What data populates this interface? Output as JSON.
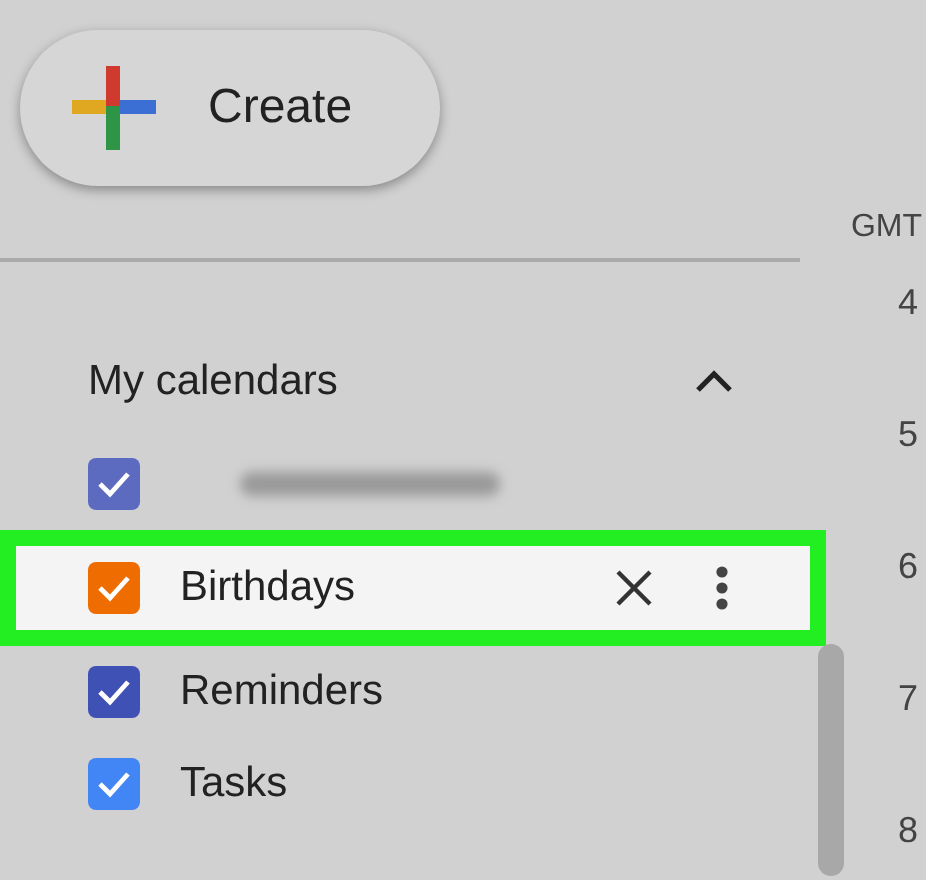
{
  "create_button": {
    "label": "Create"
  },
  "timezone": "GMT",
  "hours": [
    "4",
    "5",
    "6",
    "7",
    "8"
  ],
  "my_calendars": {
    "title": "My calendars",
    "expanded": true,
    "items": [
      {
        "kind": "redacted",
        "checked": true,
        "color": "#5c6bc0",
        "selected": false
      },
      {
        "kind": "calendar",
        "name": "Birthdays",
        "checked": true,
        "color": "#ef6c00",
        "selected": true
      },
      {
        "kind": "calendar",
        "name": "Reminders",
        "checked": true,
        "color": "#3f51b5",
        "selected": false
      },
      {
        "kind": "calendar",
        "name": "Tasks",
        "checked": true,
        "color": "#4285f4",
        "selected": false
      }
    ]
  }
}
